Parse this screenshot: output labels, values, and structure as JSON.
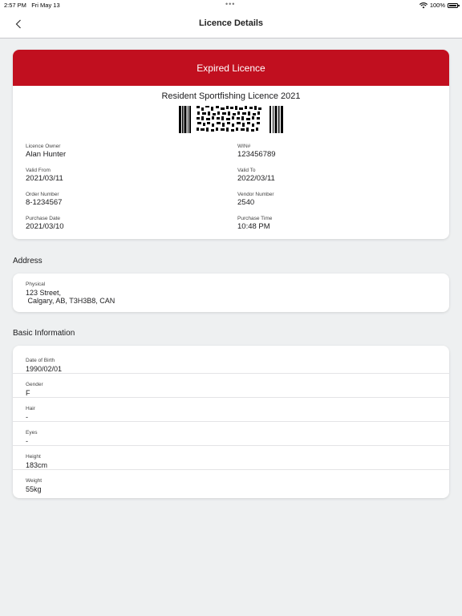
{
  "status_bar": {
    "time": "2:57 PM",
    "date": "Fri May 13",
    "battery": "100%",
    "dots": "•••"
  },
  "nav": {
    "title": "Licence Details"
  },
  "licence": {
    "status": "Expired Licence",
    "name": "Resident Sportfishing Licence 2021",
    "fields": {
      "owner": {
        "label": "Licence Owner",
        "value": "Alan Hunter"
      },
      "win": {
        "label": "WIN#",
        "value": "123456789"
      },
      "valid_from": {
        "label": "Valid From",
        "value": "2021/03/11"
      },
      "valid_to": {
        "label": "Valid To",
        "value": "2022/03/11"
      },
      "order_number": {
        "label": "Order Number",
        "value": "8-1234567"
      },
      "vendor_number": {
        "label": "Vendor Number",
        "value": "2540"
      },
      "purchase_date": {
        "label": "Purchase Date",
        "value": "2021/03/10"
      },
      "purchase_time": {
        "label": "Purchase Time",
        "value": "10:48 PM"
      }
    }
  },
  "address": {
    "section_title": "Address",
    "label": "Physical",
    "line1": "123 Street,",
    "line2": " Calgary, AB, T3H3B8, CAN"
  },
  "basic": {
    "section_title": "Basic Information",
    "rows": [
      {
        "label": "Date of Birth",
        "value": "1990/02/01"
      },
      {
        "label": "Gender",
        "value": "F"
      },
      {
        "label": "Hair",
        "value": "-"
      },
      {
        "label": "Eyes",
        "value": "-"
      },
      {
        "label": "Height",
        "value": "183cm"
      },
      {
        "label": "Weight",
        "value": "55kg"
      }
    ]
  },
  "colors": {
    "accent": "#c10f1f",
    "background": "#eef0f1",
    "card": "#ffffff"
  }
}
